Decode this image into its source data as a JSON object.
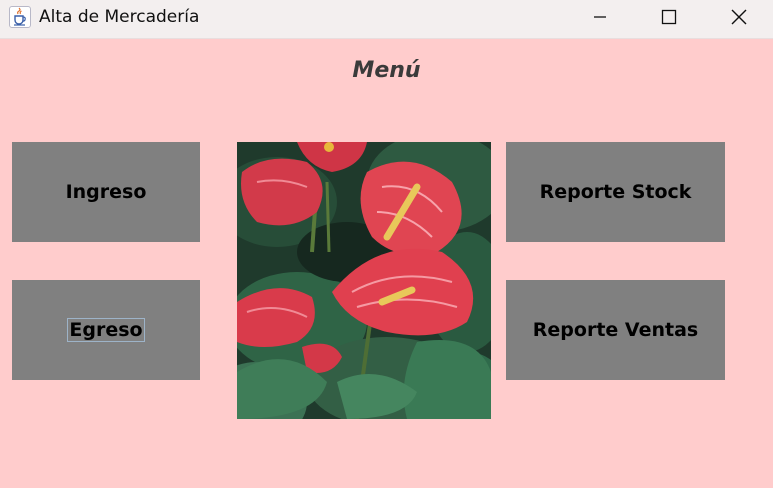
{
  "window": {
    "title": "Alta de Mercadería",
    "app_icon": "java-cup-icon",
    "controls": [
      "minimize-icon",
      "maximize-icon",
      "close-icon"
    ]
  },
  "menu": {
    "title": "Menú"
  },
  "buttons": {
    "ingreso": "Ingreso",
    "egreso": "Egreso",
    "reporte_stock": "Reporte Stock",
    "reporte_ventas": "Reporte Ventas"
  },
  "image": {
    "subject": "red anthurium flowers"
  },
  "colors": {
    "background": "#ffcccc",
    "button": "#808080",
    "titlebar": "#f3efef"
  }
}
